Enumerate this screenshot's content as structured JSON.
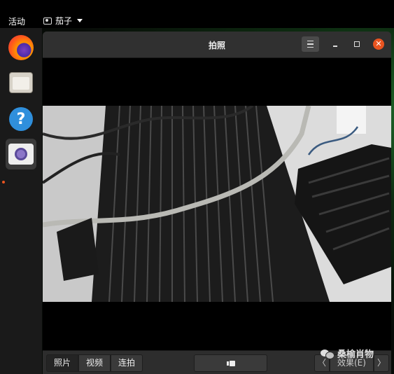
{
  "topbar": {
    "activities": "活动",
    "app_name": "茄子"
  },
  "window": {
    "title": "拍照"
  },
  "modes": {
    "photo": "照片",
    "video": "视频",
    "burst": "连拍"
  },
  "effects": {
    "prev": "〈",
    "label": "效果(E)",
    "next": "〉"
  },
  "watermark": {
    "text": "桑榆肖物"
  },
  "icons": [
    "firefox-icon",
    "files-icon",
    "help-icon",
    "cheese-icon",
    "menu-icon",
    "minimize-icon",
    "maximize-icon",
    "close-icon",
    "shutter-icon"
  ],
  "colors": {
    "accent": "#e95420",
    "dock": "#1a1a1a",
    "window": "#2b2b2b"
  }
}
